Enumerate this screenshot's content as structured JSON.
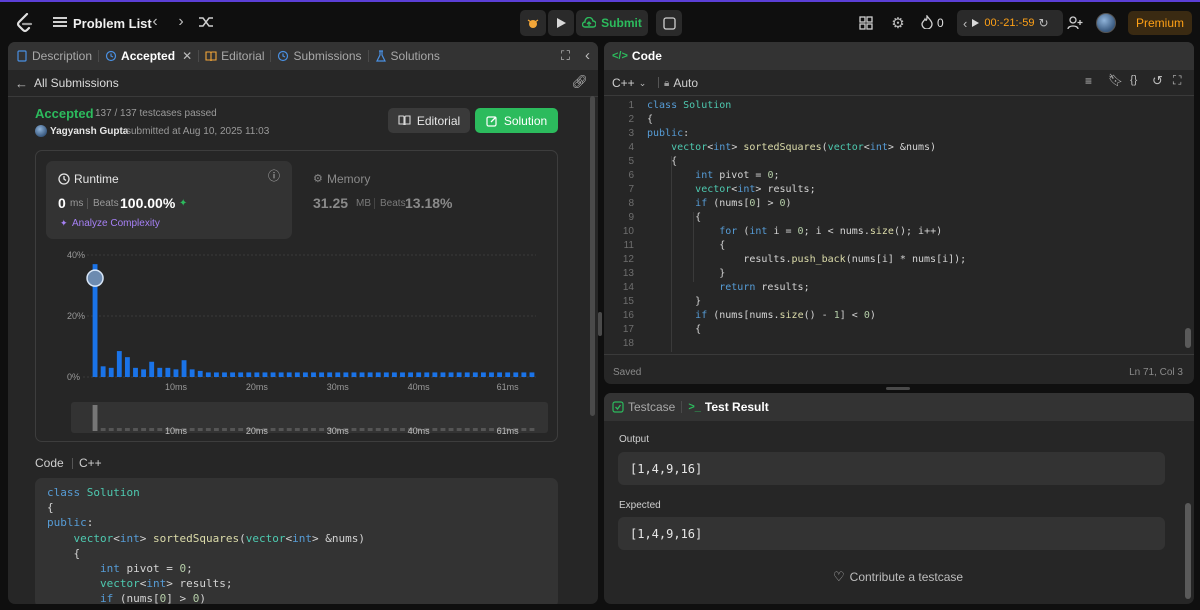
{
  "topbar": {
    "logo_icon": "leetcode-logo",
    "problem_list": "Problem List",
    "submit": "Submit",
    "streak": "0",
    "timer": "00:-21:-59",
    "premium": "Premium"
  },
  "left": {
    "tabs": [
      "Description",
      "Accepted",
      "Editorial",
      "Submissions",
      "Solutions"
    ],
    "back": "All Submissions",
    "status": "Accepted",
    "testcases": "137 / 137 testcases passed",
    "user": "Yagyansh Gupta",
    "submitted": "submitted at Aug 10, 2025 11:03",
    "editorial_btn": "Editorial",
    "solution_btn": "Solution",
    "runtime_label": "Runtime",
    "runtime_value": "0",
    "runtime_unit": "ms",
    "beats_label": "Beats",
    "runtime_beats": "100.00%",
    "analyze": "Analyze Complexity",
    "memory_label": "Memory",
    "memory_value": "31.25",
    "memory_unit": "MB",
    "memory_beats": "13.18%",
    "code_label": "Code",
    "lang": "C++"
  },
  "chart_data": {
    "type": "bar",
    "y_ticks": [
      "40%",
      "20%",
      "0%"
    ],
    "ylim": [
      0,
      40
    ],
    "x_ticks": [
      "10ms",
      "20ms",
      "30ms",
      "40ms",
      "61ms"
    ],
    "x_tick_positions": [
      10,
      20,
      30,
      40,
      51
    ],
    "values": [
      37,
      3.5,
      3,
      8.5,
      6.5,
      3,
      2.5,
      5,
      3,
      3,
      2.5,
      5.5,
      2.5,
      2,
      1.5,
      1.5,
      1.5,
      1.5,
      1.5,
      1.5,
      1.5,
      1.5,
      1.5,
      1.5,
      1.5,
      1.5,
      1.5,
      1.5,
      1.5,
      1.5,
      1.5,
      1.5,
      1.5,
      1.5,
      1.5,
      1.5,
      1.5,
      1.5,
      1.5,
      1.5,
      1.5,
      1.5,
      1.5,
      1.5,
      1.5,
      1.5,
      1.5,
      1.5,
      1.5,
      1.5,
      1.5,
      1.5,
      1.5,
      1.5,
      1.5
    ],
    "highlight_index": 0,
    "grid": true
  },
  "editor": {
    "title": "Code",
    "lang": "C++",
    "mode": "Auto",
    "status": "Saved",
    "cursor": "Ln 71, Col 3",
    "lines": [
      "class Solution",
      "{",
      "public:",
      "    vector<int> sortedSquares(vector<int> &nums)",
      "    {",
      "        int pivot = 0;",
      "        vector<int> results;",
      "        if (nums[0] > 0)",
      "        {",
      "            for (int i = 0; i < nums.size(); i++)",
      "            {",
      "                results.push_back(nums[i] * nums[i]);",
      "            }",
      "            return results;",
      "        }",
      "        if (nums[nums.size() - 1] < 0)",
      "        {",
      ""
    ],
    "line_numbers": [
      "1",
      "2",
      "3",
      "4",
      "5",
      "6",
      "7",
      "8",
      "9",
      "10",
      "11",
      "12",
      "13",
      "14",
      "15",
      "16",
      "17",
      "18"
    ]
  },
  "submission_code": [
    "class Solution",
    "{",
    "public:",
    "    vector<int> sortedSquares(vector<int> &nums)",
    "    {",
    "        int pivot = 0;",
    "        vector<int> results;",
    "        if (nums[0] > 0)"
  ],
  "result": {
    "tab_testcase": "Testcase",
    "tab_result": "Test Result",
    "output_label": "Output",
    "output_value": "[1,4,9,16]",
    "expected_label": "Expected",
    "expected_value": "[1,4,9,16]",
    "contribute": "Contribute a testcase"
  },
  "colors": {
    "accent_green": "#2cbb5d",
    "bar_blue": "#1a73e8",
    "premium": "#ffa116"
  }
}
